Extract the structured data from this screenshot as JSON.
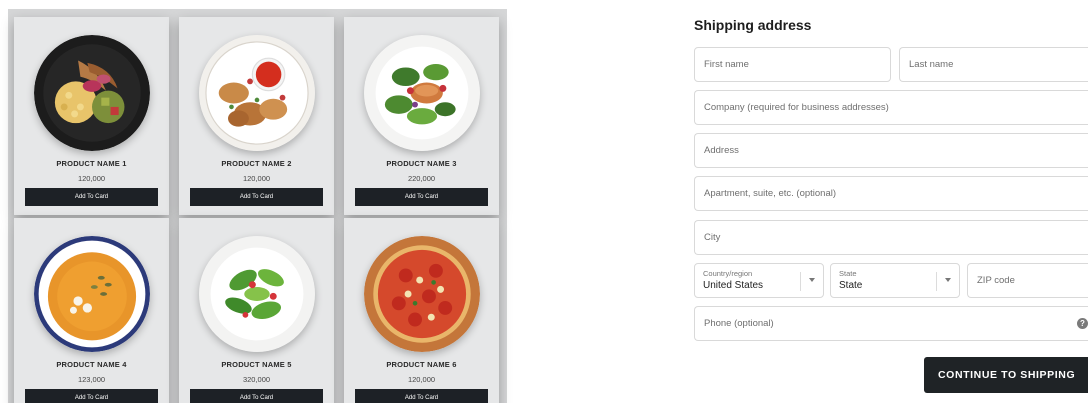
{
  "products": [
    {
      "name": "PRODUCT NAME 1",
      "price": "120,000",
      "button": "Add To Card",
      "image_icon": "rice-bowl-icon"
    },
    {
      "name": "PRODUCT NAME 2",
      "price": "120,000",
      "button": "Add To Card",
      "image_icon": "chicken-wings-icon"
    },
    {
      "name": "PRODUCT NAME 3",
      "price": "220,000",
      "button": "Add To Card",
      "image_icon": "salmon-salad-icon"
    },
    {
      "name": "PRODUCT NAME 4",
      "price": "123,000",
      "button": "Add To Card",
      "image_icon": "pumpkin-soup-icon"
    },
    {
      "name": "PRODUCT NAME 5",
      "price": "320,000",
      "button": "Add To Card",
      "image_icon": "green-salad-icon"
    },
    {
      "name": "PRODUCT NAME 6",
      "price": "120,000",
      "button": "Add To Card",
      "image_icon": "pizza-icon"
    }
  ],
  "shipping": {
    "title": "Shipping address",
    "first_name": {
      "placeholder": "First name",
      "value": ""
    },
    "last_name": {
      "placeholder": "Last name",
      "value": ""
    },
    "company": {
      "placeholder": "Company (required for business addresses)",
      "value": ""
    },
    "address": {
      "placeholder": "Address",
      "value": ""
    },
    "apartment": {
      "placeholder": "Apartment, suite, etc. (optional)",
      "value": ""
    },
    "city": {
      "placeholder": "City",
      "value": ""
    },
    "country": {
      "label": "Country/region",
      "value": "United States"
    },
    "state": {
      "label": "State",
      "value": "State"
    },
    "zip": {
      "placeholder": "ZIP code",
      "value": ""
    },
    "phone": {
      "placeholder": "Phone (optional)",
      "value": ""
    },
    "help_icon": "?",
    "continue_label": "CONTINUE TO SHIPPING"
  },
  "colors": {
    "button_dark": "#1d2126",
    "card_bg": "#e6e7e8",
    "grid_bg": "#d5d6d7",
    "field_border": "#d9d9d9"
  }
}
